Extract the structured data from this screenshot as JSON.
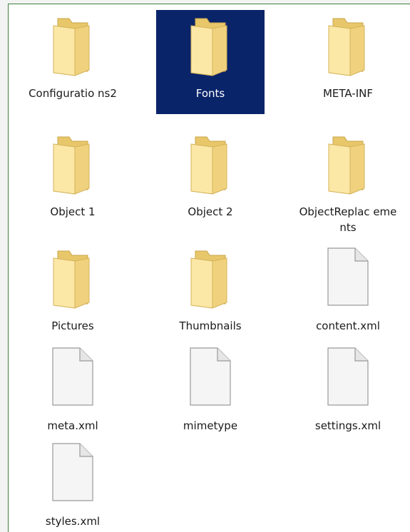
{
  "window": {
    "content_area": "file-list"
  },
  "items": [
    {
      "name": "Configurations2",
      "label": "Configuratio ns2",
      "type": "folder",
      "selected": false
    },
    {
      "name": "Fonts",
      "label": "Fonts",
      "type": "folder",
      "selected": true
    },
    {
      "name": "META-INF",
      "label": "META-INF",
      "type": "folder",
      "selected": false
    },
    {
      "name": "Object 1",
      "label": "Object 1",
      "type": "folder",
      "selected": false
    },
    {
      "name": "Object 2",
      "label": "Object 2",
      "type": "folder",
      "selected": false
    },
    {
      "name": "ObjectReplacements",
      "label": "ObjectReplac ements",
      "type": "folder",
      "selected": false
    },
    {
      "name": "Pictures",
      "label": "Pictures",
      "type": "folder",
      "selected": false
    },
    {
      "name": "Thumbnails",
      "label": "Thumbnails",
      "type": "folder",
      "selected": false
    },
    {
      "name": "content.xml",
      "label": "content.xml",
      "type": "file",
      "selected": false
    },
    {
      "name": "meta.xml",
      "label": "meta.xml",
      "type": "file",
      "selected": false
    },
    {
      "name": "mimetype",
      "label": "mimetype",
      "type": "file",
      "selected": false
    },
    {
      "name": "settings.xml",
      "label": "settings.xml",
      "type": "file",
      "selected": false
    },
    {
      "name": "styles.xml",
      "label": "styles.xml",
      "type": "file",
      "selected": false
    }
  ],
  "colors": {
    "selection_bg": "#0a246a",
    "selection_text": "#ffffff",
    "folder_light": "#fbe7a6",
    "folder_dark": "#e8c76a",
    "file_fill": "#f5f5f5",
    "file_stroke": "#9a9a9a"
  }
}
